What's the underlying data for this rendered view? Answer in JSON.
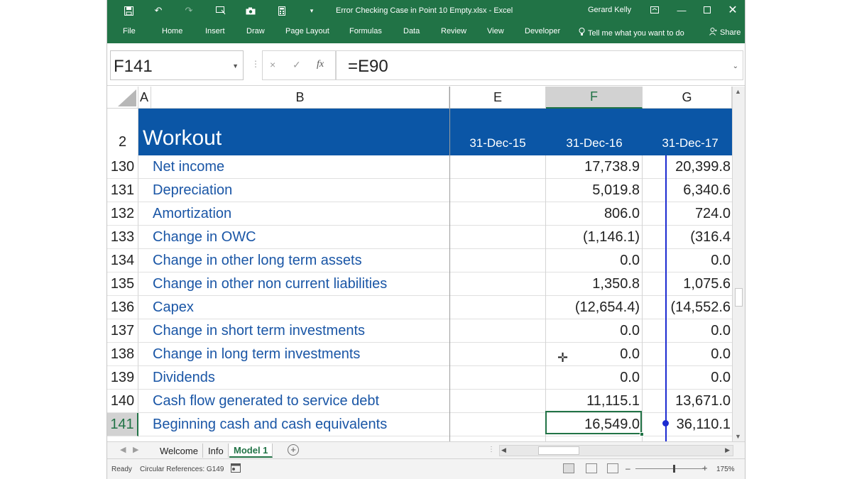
{
  "window": {
    "title": "Error Checking Case in Point 10 Empty.xlsx  -  Excel",
    "user": "Gerard Kelly"
  },
  "quick_access": [
    "save-icon",
    "undo-icon",
    "redo-icon",
    "touch-mode-icon",
    "camera-icon",
    "calculator-icon",
    "customize-qat-icon"
  ],
  "ribbon": {
    "tabs": [
      "File",
      "Home",
      "Insert",
      "Draw",
      "Page Layout",
      "Formulas",
      "Data",
      "Review",
      "View",
      "Developer"
    ],
    "tell_me": "Tell me what you want to do",
    "share": "Share"
  },
  "formula_bar": {
    "name_box": "F141",
    "cancel": "×",
    "enter": "✓",
    "fx": "fx",
    "formula": "=E90"
  },
  "columns": [
    "A",
    "B",
    "E",
    "F",
    "G"
  ],
  "banner": {
    "row_number": "2",
    "title": "Workout",
    "dates": [
      "31-Dec-15",
      "31-Dec-16",
      "31-Dec-17"
    ]
  },
  "rows": [
    {
      "num": "130",
      "label": "Net income",
      "f": "17,738.9",
      "g": "20,399.8"
    },
    {
      "num": "131",
      "label": "Depreciation",
      "f": "5,019.8",
      "g": "6,340.6"
    },
    {
      "num": "132",
      "label": "Amortization",
      "f": "806.0",
      "g": "724.0"
    },
    {
      "num": "133",
      "label": "Change in OWC",
      "f": "(1,146.1)",
      "g": "(316.4"
    },
    {
      "num": "134",
      "label": "Change in other long term assets",
      "f": "0.0",
      "g": "0.0"
    },
    {
      "num": "135",
      "label": "Change in other non current liabilities",
      "f": "1,350.8",
      "g": "1,075.6"
    },
    {
      "num": "136",
      "label": "Capex",
      "f": "(12,654.4)",
      "g": "(14,552.6"
    },
    {
      "num": "137",
      "label": "Change in short term investments",
      "f": "0.0",
      "g": "0.0"
    },
    {
      "num": "138",
      "label": "Change in long term investments",
      "f": "0.0",
      "g": "0.0"
    },
    {
      "num": "139",
      "label": "Dividends",
      "f": "0.0",
      "g": "0.0"
    },
    {
      "num": "140",
      "label": "Cash flow generated to service debt",
      "f": "11,115.1",
      "g": "13,671.0"
    },
    {
      "num": "141",
      "label": "Beginning cash and cash equivalents",
      "f": "16,549.0",
      "g": "36,110.1"
    }
  ],
  "sheet_tabs": [
    "Welcome",
    "Info",
    "Model 1"
  ],
  "active_sheet": "Model 1",
  "status": {
    "ready": "Ready",
    "circular": "Circular References: G149",
    "zoom": "175%"
  },
  "colors": {
    "excel_green": "#217346",
    "banner_blue": "#0b56a6",
    "label_blue": "#1a56a6",
    "tracer_blue": "#1c2bd1"
  }
}
